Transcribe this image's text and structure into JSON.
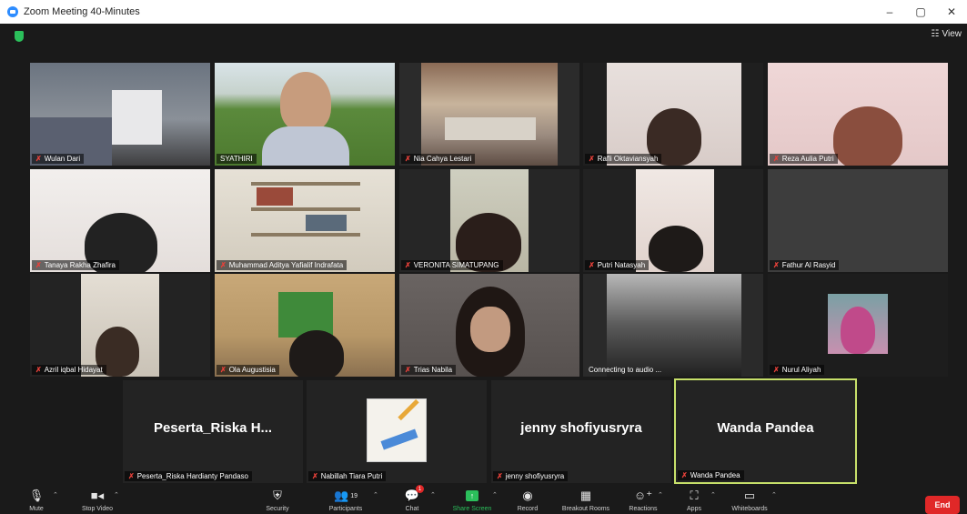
{
  "window": {
    "title": "Zoom Meeting 40-Minutes",
    "minimize": "–",
    "maximize": "▢",
    "close": "✕"
  },
  "header": {
    "view_label": "View",
    "view_icon": "grid-icon"
  },
  "participants_grid": [
    {
      "name": "Wulan Dari",
      "muted": true
    },
    {
      "name": "SYATHIRI",
      "muted": false
    },
    {
      "name": "Nia Cahya Lestari",
      "muted": true
    },
    {
      "name": "Rafli Oktaviansyah",
      "muted": true
    },
    {
      "name": "Reza Aulia Putri",
      "muted": true
    },
    {
      "name": "Tanaya Rakha Zhafira",
      "muted": true
    },
    {
      "name": "Muhammad Aditya Yafialif Indrafata",
      "muted": true
    },
    {
      "name": "VERONITA SIMATUPANG",
      "muted": true
    },
    {
      "name": "Putri Natasyah",
      "muted": true
    },
    {
      "name": "Fathur Al Rasyid",
      "muted": true
    },
    {
      "name": "Azril iqbal Hidayat",
      "muted": true
    },
    {
      "name": "Ola Augustisia",
      "muted": true
    },
    {
      "name": "Trias Nabila",
      "muted": true
    },
    {
      "name": "Connecting to audio ...",
      "muted": false
    },
    {
      "name": "Nurul Aliyah",
      "muted": true
    }
  ],
  "bottom_row": [
    {
      "display": "Peserta_Riska H...",
      "name": "Peserta_Riska Hardianty Pandaso"
    },
    {
      "display": "",
      "name": "Nabillah Tiara Putri"
    },
    {
      "display": "jenny shofiyusryra",
      "name": "jenny shofiyusryra"
    },
    {
      "display": "Wanda Pandea",
      "name": "Wanda Pandea"
    }
  ],
  "toolbar": {
    "mute": "Mute",
    "stop_video": "Stop Video",
    "security": "Security",
    "participants": "Participants",
    "participants_count": "19",
    "chat": "Chat",
    "chat_badge": "1",
    "share_screen": "Share Screen",
    "record": "Record",
    "breakout": "Breakout Rooms",
    "reactions": "Reactions",
    "apps": "Apps",
    "whiteboards": "Whiteboards",
    "end": "End"
  },
  "colors": {
    "accent": "#2d8cff",
    "end": "#e02828",
    "active_speaker": "#c7e06a",
    "share_green": "#2bbf5b"
  }
}
